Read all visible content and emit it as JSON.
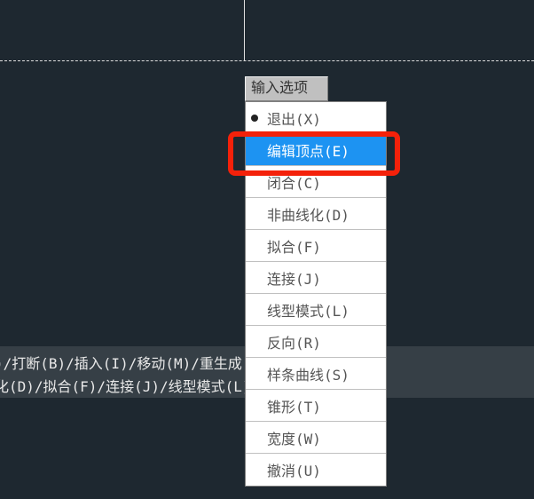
{
  "menu": {
    "header": "输入选项",
    "items": [
      {
        "label": "退出(X)",
        "bullet": true,
        "selected": false
      },
      {
        "label": "编辑顶点(E)",
        "bullet": false,
        "selected": true
      },
      {
        "label": "闭合(C)",
        "bullet": false,
        "selected": false
      },
      {
        "label": "非曲线化(D)",
        "bullet": false,
        "selected": false
      },
      {
        "label": "拟合(F)",
        "bullet": false,
        "selected": false
      },
      {
        "label": "连接(J)",
        "bullet": false,
        "selected": false
      },
      {
        "label": "线型模式(L)",
        "bullet": false,
        "selected": false
      },
      {
        "label": "反向(R)",
        "bullet": false,
        "selected": false
      },
      {
        "label": "样条曲线(S)",
        "bullet": false,
        "selected": false
      },
      {
        "label": "锥形(T)",
        "bullet": false,
        "selected": false
      },
      {
        "label": "宽度(W)",
        "bullet": false,
        "selected": false
      },
      {
        "label": "撤消(U)",
        "bullet": false,
        "selected": false
      }
    ]
  },
  "command_line": {
    "line1": ")/打断(B)/插入(I)/移动(M)/重生成(R)/选择(SE)/拉直(",
    "line2": "化(D)/拟合(F)/连接(J)/线型模式(L)/反向(R)/样条曲线"
  },
  "highlight": {
    "target_index": 1
  }
}
